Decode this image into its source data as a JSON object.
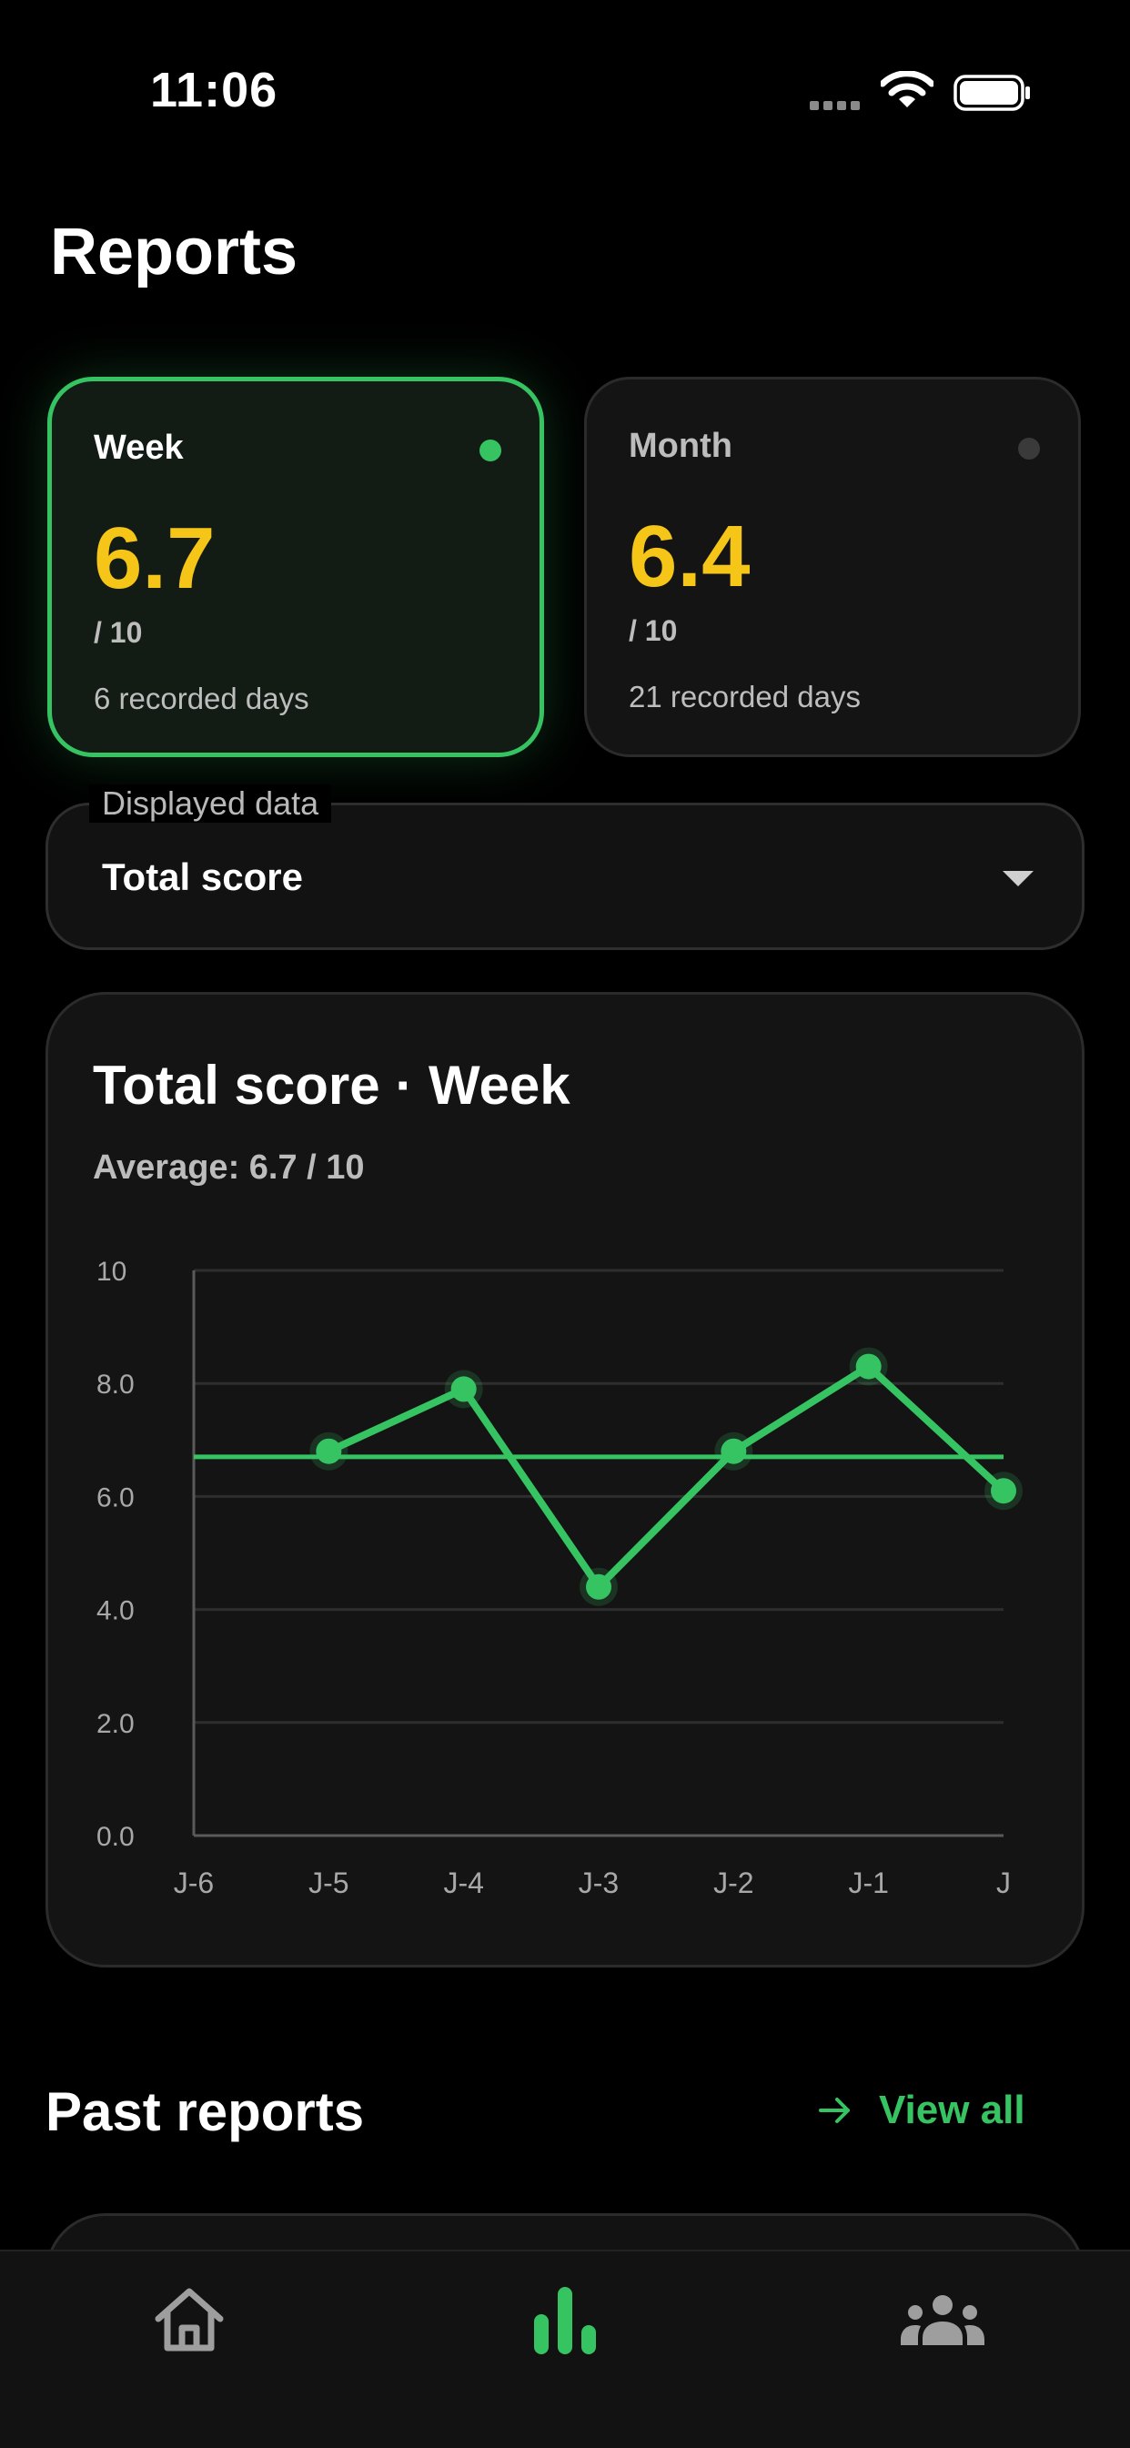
{
  "status_bar": {
    "time": "11:06"
  },
  "header": {
    "title": "Reports"
  },
  "periods": [
    {
      "label": "Week",
      "score": "6.7",
      "denominator": "/ 10",
      "days": "6 recorded days",
      "selected": true
    },
    {
      "label": "Month",
      "score": "6.4",
      "denominator": "/ 10",
      "days": "21 recorded days",
      "selected": false
    }
  ],
  "displayed_data": {
    "label": "Displayed data",
    "value": "Total score"
  },
  "chart_card": {
    "title": "Total score · Week",
    "subtitle": "Average: 6.7 / 10"
  },
  "chart_data": {
    "type": "line",
    "categories": [
      "J-6",
      "J-5",
      "J-4",
      "J-3",
      "J-2",
      "J-1",
      "J"
    ],
    "series": [
      {
        "values": [
          null,
          6.8,
          7.9,
          4.4,
          6.8,
          8.3,
          6.1
        ]
      }
    ],
    "average_line": 6.7,
    "ylim": [
      0,
      10
    ],
    "yticks": [
      "0.0",
      "2.0",
      "4.0",
      "6.0",
      "8.0",
      "10"
    ],
    "grid": true,
    "colors": {
      "line": "#36c463",
      "grid": "#2e2e2e",
      "axis": "#5a5a5a"
    }
  },
  "past_reports": {
    "title": "Past reports",
    "view_all": "View all"
  },
  "tab_bar": {
    "items": [
      "home-icon",
      "bar-chart-icon",
      "group-icon"
    ],
    "active_color": "#36c463",
    "inactive_color": "#9e9e9e"
  },
  "colors": {
    "accent": "#36c463",
    "score": "#f5c518"
  }
}
